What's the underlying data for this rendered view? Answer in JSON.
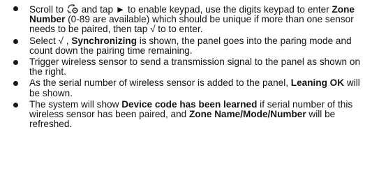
{
  "items": [
    {
      "pre_icon": "Scroll to ",
      "icon": "sync-gear-icon",
      "post_icon": " and tap ► to enable keypad, use the digits keypad to enter ",
      "bold1": "Zone Number",
      "mid1": " (0-89 are available) which should be unique if more than one sensor needs to be paired, then tap √ to to enter."
    },
    {
      "pre": "Select √ , ",
      "bold1": "Synchronizing",
      "post": " is shown, the panel goes into the paring mode and count down the pairing time remaining."
    },
    {
      "text": "Trigger wireless sensor to send a transmission signal to the panel as shown on the right."
    },
    {
      "pre": "As the serial number of wireless sensor is added to the panel, ",
      "bold1": "Leaning OK",
      "post": " will be shown."
    },
    {
      "pre": "The system will show ",
      "bold1": "Device code has been learned",
      "mid": " if serial number of this wireless sensor has been paired, and ",
      "bold2": "Zone Name/Mode/Number",
      "post": " will be refreshed."
    }
  ]
}
